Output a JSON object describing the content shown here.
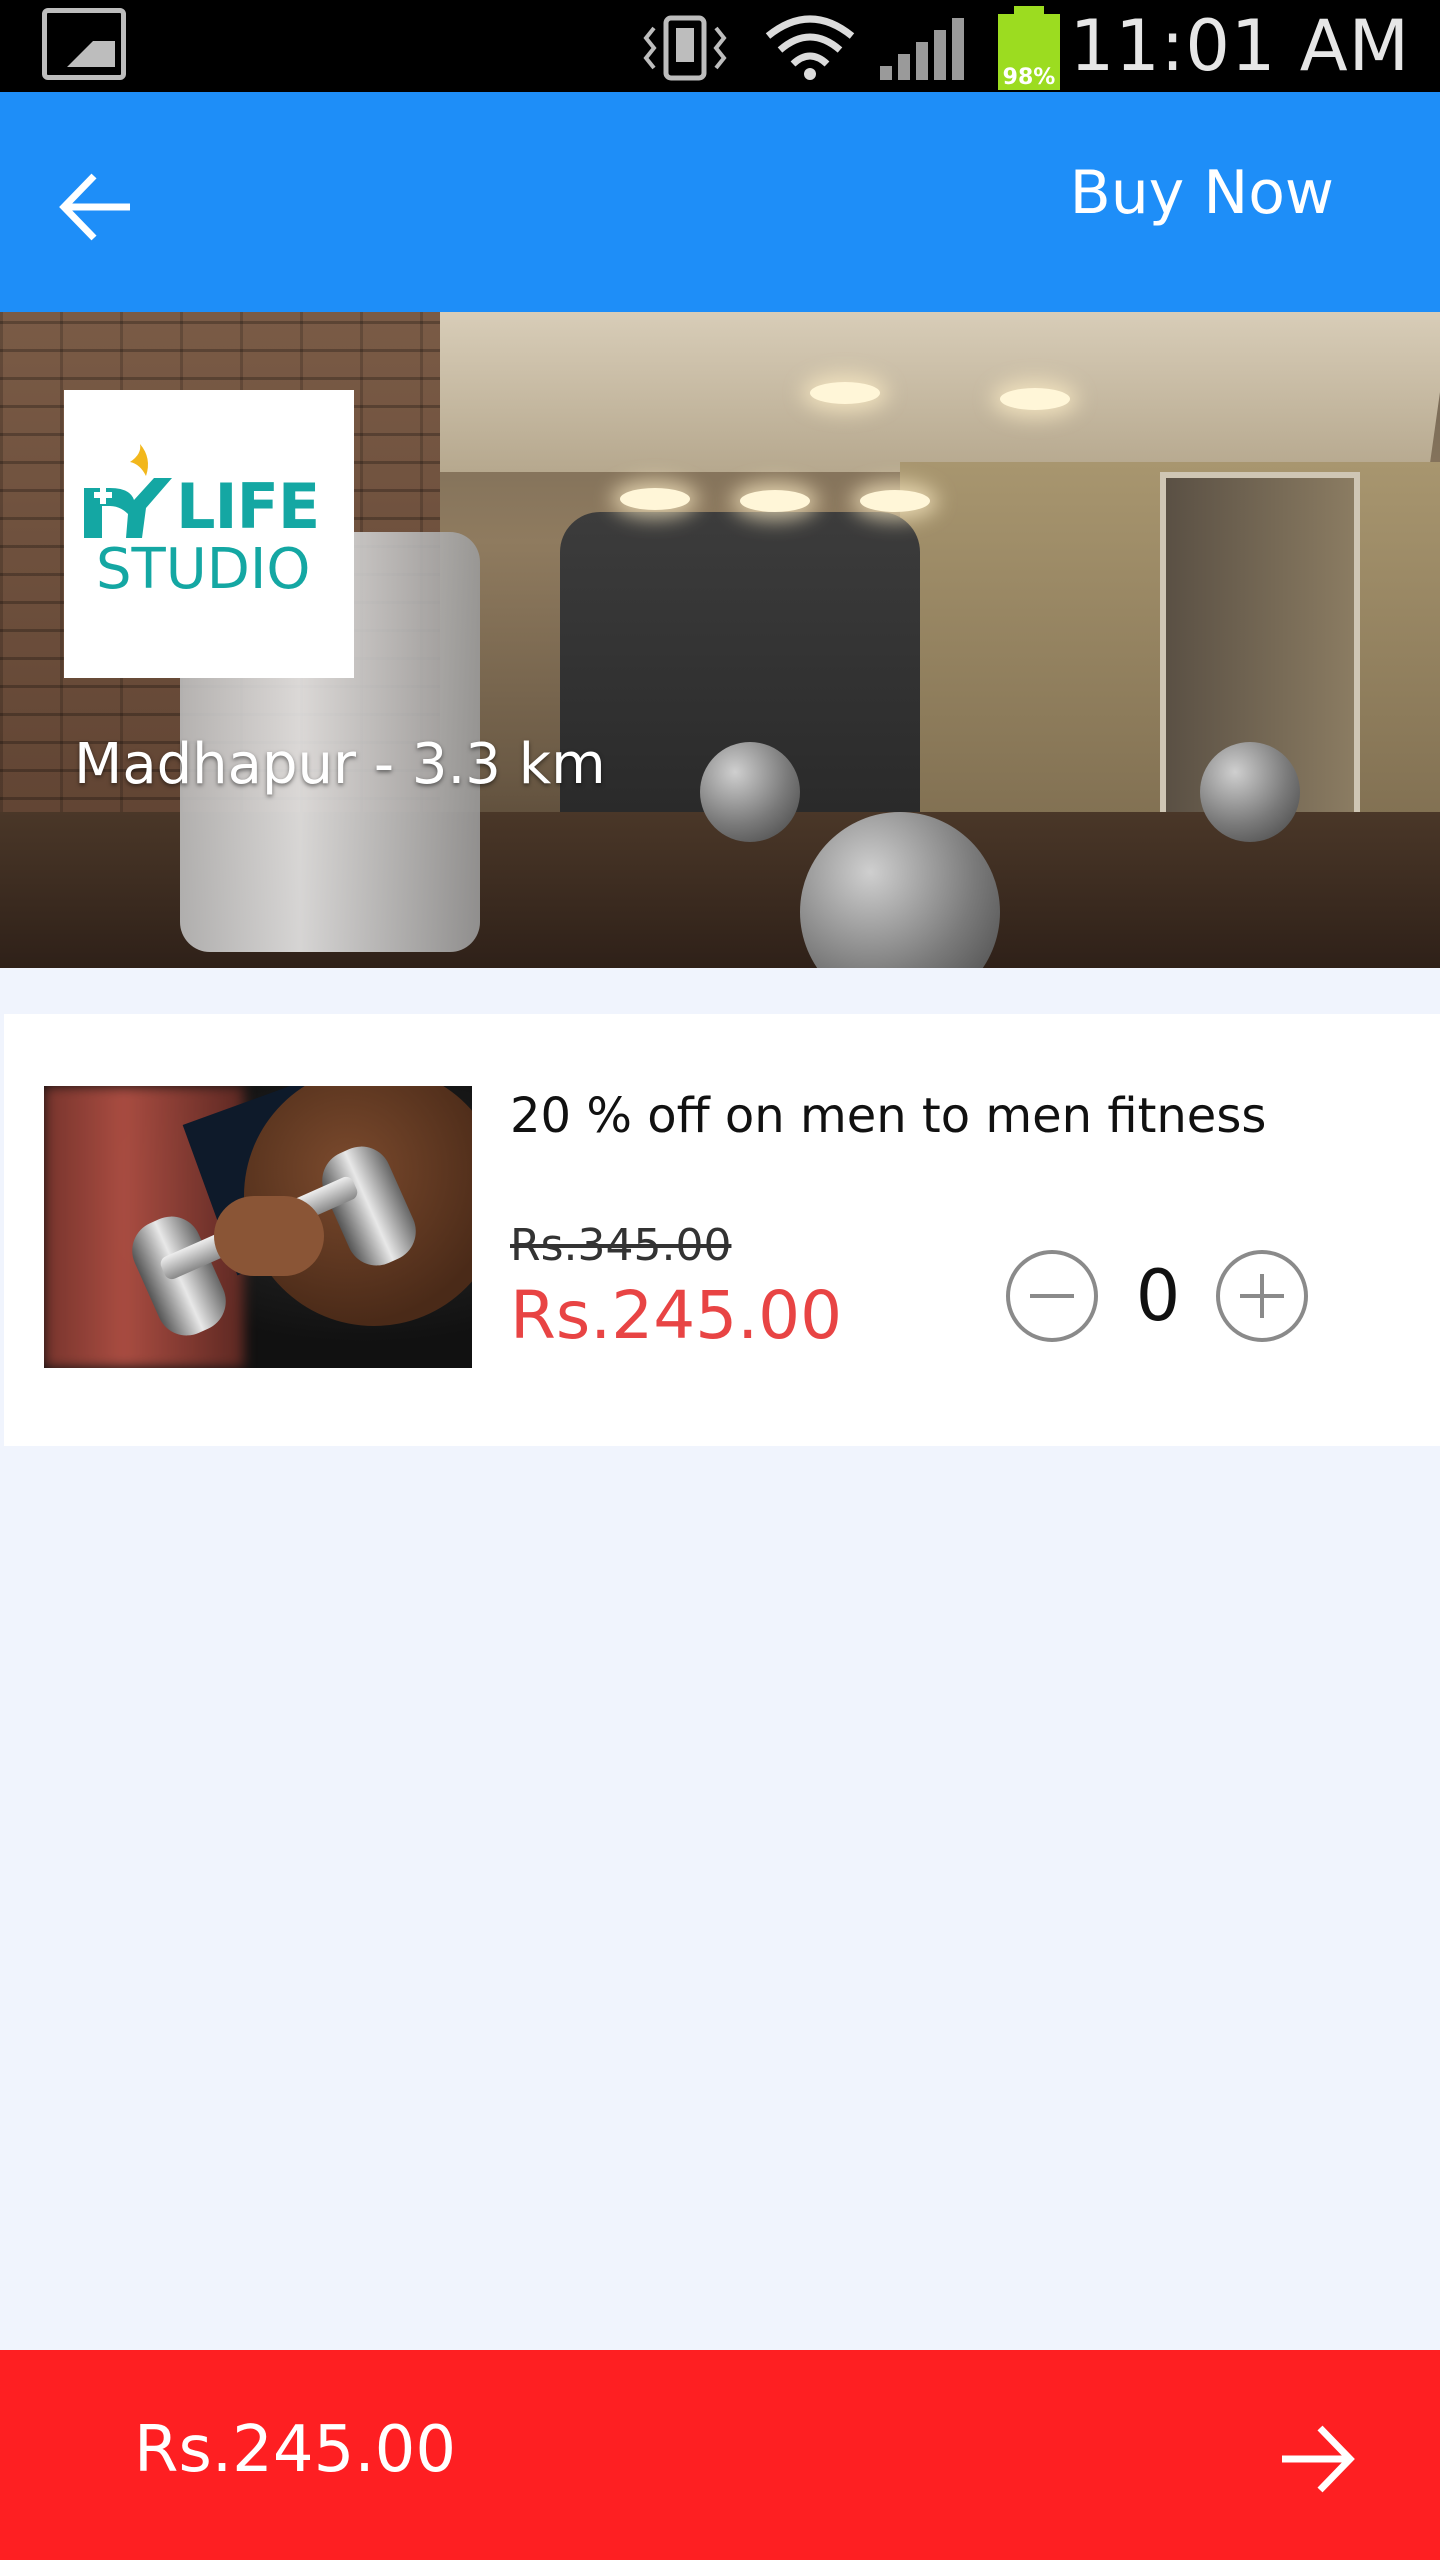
{
  "status_bar": {
    "time": "11:01 AM",
    "battery_level": "98%",
    "icons": [
      "gallery-icon",
      "vibrate-icon",
      "wifi-icon",
      "signal-icon",
      "battery-icon"
    ]
  },
  "header": {
    "back_icon": "arrow-left-icon",
    "buy_now_label": "Buy Now",
    "color": "#1e8ef8"
  },
  "hero": {
    "logo_line1": "LIFE",
    "logo_line2": "STUDIO",
    "logo_color": "#14a7a3",
    "location": "Madhapur - 3.3 km"
  },
  "offer": {
    "title": "20  % off on men to men fitness",
    "original_price": "Rs.345.00",
    "discounted_price": "Rs.245.00",
    "quantity": "0",
    "price_color": "#e84444",
    "minus_icon": "minus-circle-icon",
    "plus_icon": "plus-circle-icon"
  },
  "footer": {
    "total": "Rs.245.00",
    "proceed_icon": "arrow-right-icon",
    "color": "#fe1f22"
  }
}
